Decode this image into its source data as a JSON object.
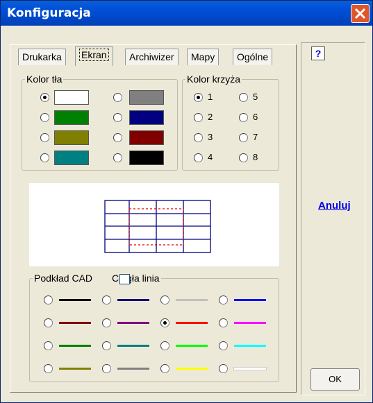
{
  "window": {
    "title": "Konfiguracja"
  },
  "tabs": [
    {
      "label": "Drukarka",
      "active": false
    },
    {
      "label": "Ekran",
      "active": true
    },
    {
      "label": "Archiwizer",
      "active": false
    },
    {
      "label": "Mapy",
      "active": false
    },
    {
      "label": "Ogólne",
      "active": false
    }
  ],
  "background_color_group": {
    "legend": "Kolor tła",
    "options": [
      {
        "color": "#ffffff",
        "selected": true
      },
      {
        "color": "#808080",
        "selected": false
      },
      {
        "color": "#008000",
        "selected": false
      },
      {
        "color": "#000080",
        "selected": false
      },
      {
        "color": "#808000",
        "selected": false
      },
      {
        "color": "#800000",
        "selected": false
      },
      {
        "color": "#008080",
        "selected": false
      },
      {
        "color": "#000000",
        "selected": false
      }
    ]
  },
  "cross_color_group": {
    "legend": "Kolor krzyża",
    "options": [
      "1",
      "5",
      "2",
      "6",
      "3",
      "7",
      "4",
      "8"
    ],
    "selected": "1"
  },
  "cad_group": {
    "legend": "Podkład CAD",
    "checkbox_label": "Ciągła linia",
    "checkbox_checked": false,
    "line_colors": [
      "#000000",
      "#000080",
      "#c0c0c0",
      "#0000ff",
      "#800000",
      "#800080",
      "#ff0000",
      "#ff00ff",
      "#008000",
      "#008080",
      "#00ff00",
      "#00ffff",
      "#808000",
      "#808080",
      "#ffff00",
      "#ffffff"
    ],
    "selected_index": 6
  },
  "side": {
    "help_label": "?",
    "cancel_label": "Anuluj",
    "ok_label": "OK"
  }
}
